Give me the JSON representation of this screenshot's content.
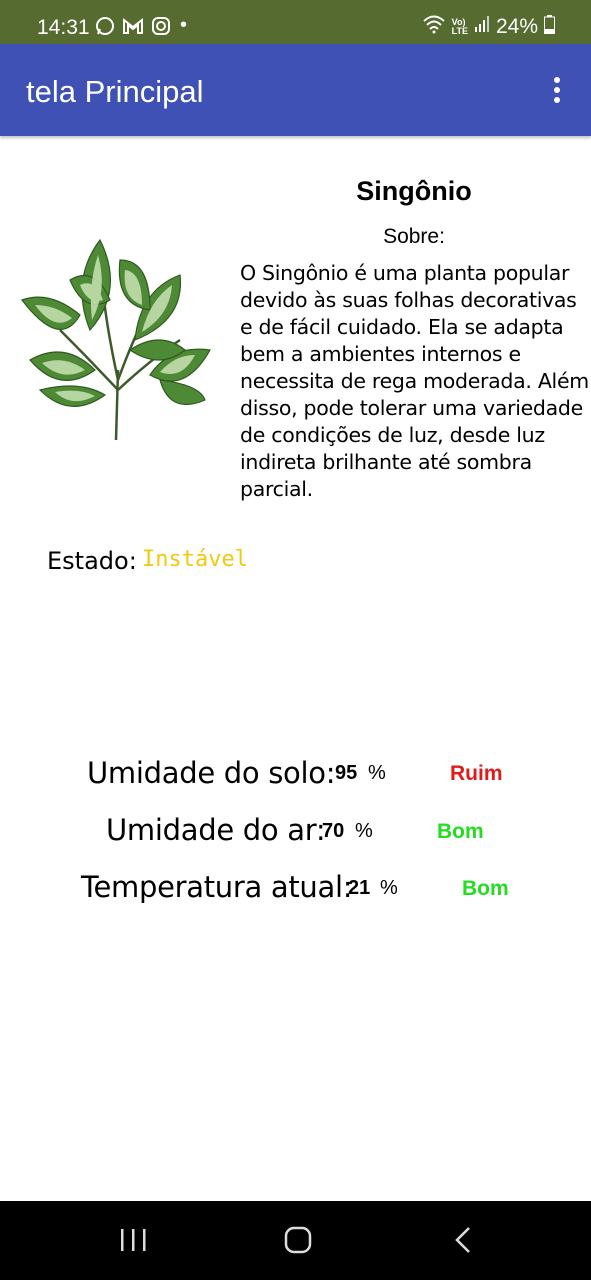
{
  "status_bar": {
    "time": "14:31",
    "notification_icons": [
      "whatsapp-icon",
      "gmail-icon",
      "instagram-icon"
    ],
    "battery": "24%",
    "network": "VoLTE"
  },
  "app_bar": {
    "title": "tela Principal",
    "menu_icon": "more-vert-icon"
  },
  "plant": {
    "name": "Singônio",
    "about_label": "Sobre:",
    "description": "O Singônio é uma planta popular devido às suas folhas decorativas e de fácil cuidado. Ela se adapta bem a ambientes internos e necessita de rega moderada. Além disso, pode tolerar uma variedade de condições de luz, desde luz indireta brilhante até sombra parcial."
  },
  "state": {
    "label": "Estado:",
    "value": "Instável",
    "color": "#f2c811"
  },
  "metrics": [
    {
      "label": "Umidade do solo:",
      "value": "95",
      "unit": "%",
      "status": "Ruim",
      "status_color": "#e01b1b"
    },
    {
      "label": "Umidade do ar:",
      "value": "70",
      "unit": "%",
      "status": "Bom",
      "status_color": "#22dd22"
    },
    {
      "label": "Temperatura atual:",
      "value": "21",
      "unit": "%",
      "status": "Bom",
      "status_color": "#22dd22"
    }
  ],
  "nav_bar": {
    "buttons": [
      "recent-apps-icon",
      "home-icon",
      "back-icon"
    ]
  }
}
